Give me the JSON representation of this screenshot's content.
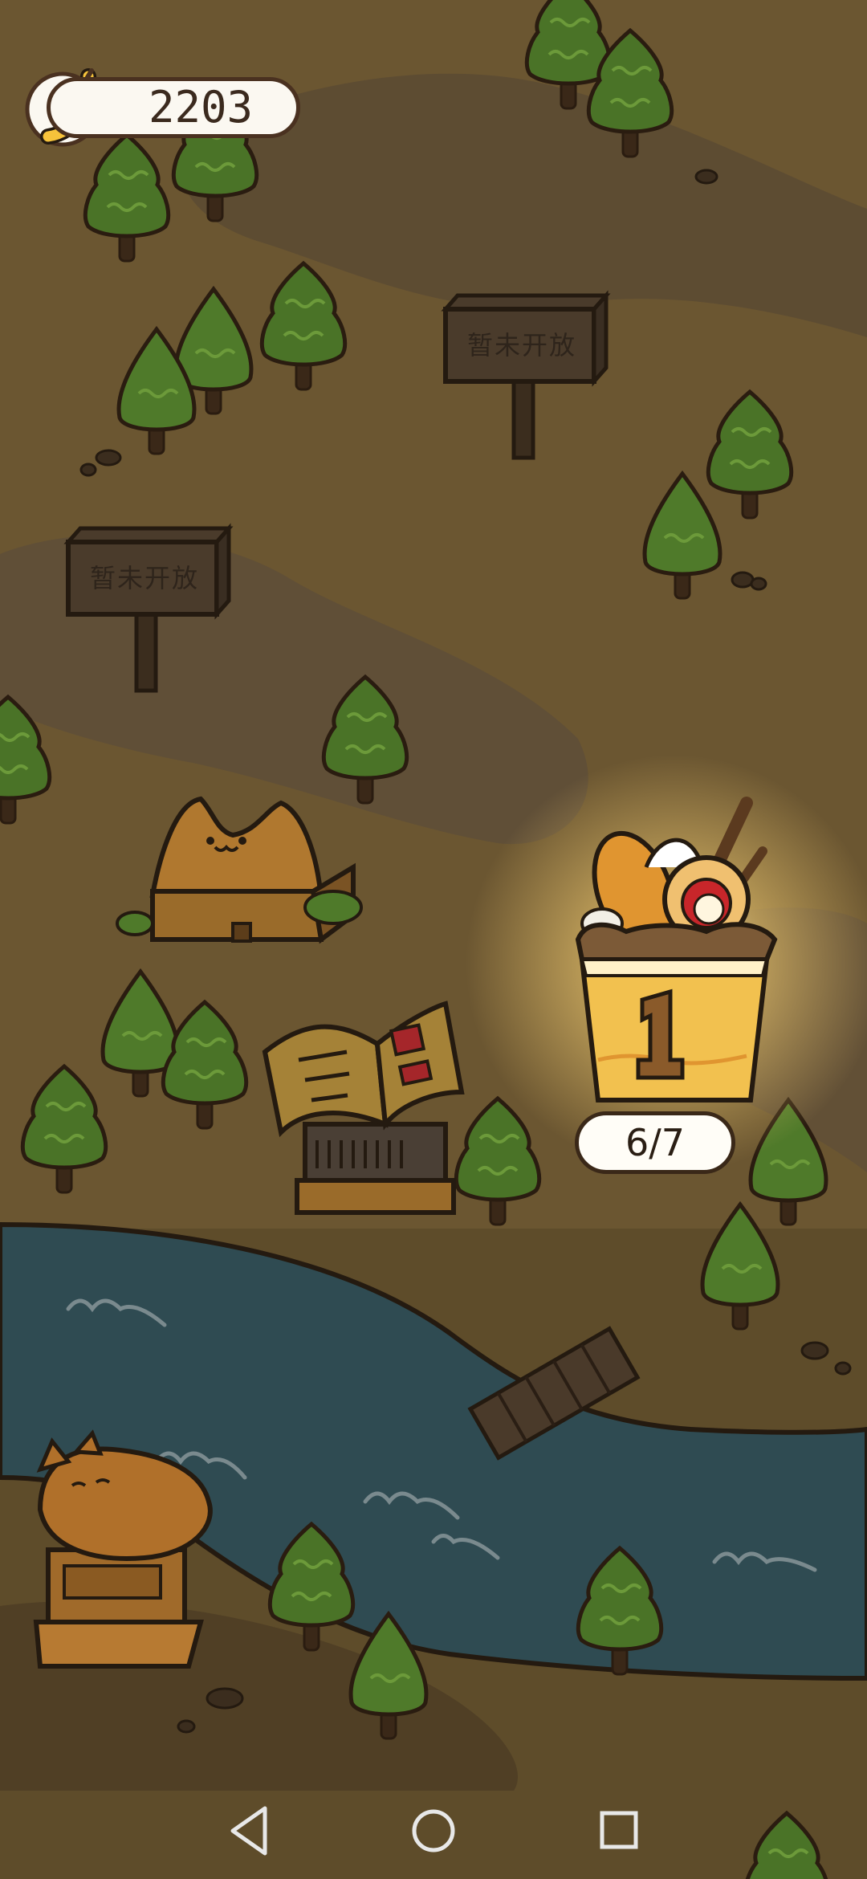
{
  "currency": {
    "icon": "banana-icon",
    "amount": "2203"
  },
  "signs": [
    {
      "text": "暂未开放"
    },
    {
      "text": "暂未开放"
    }
  ],
  "level": {
    "number": "1",
    "progress": "6/7"
  },
  "navbar": {
    "buttons": [
      "back-icon",
      "home-icon",
      "recents-icon"
    ]
  },
  "colors": {
    "ground": "#5e4c2a",
    "river": "#2f4b52",
    "glow": "#f6d27a",
    "tree": "#4f7a2a"
  }
}
